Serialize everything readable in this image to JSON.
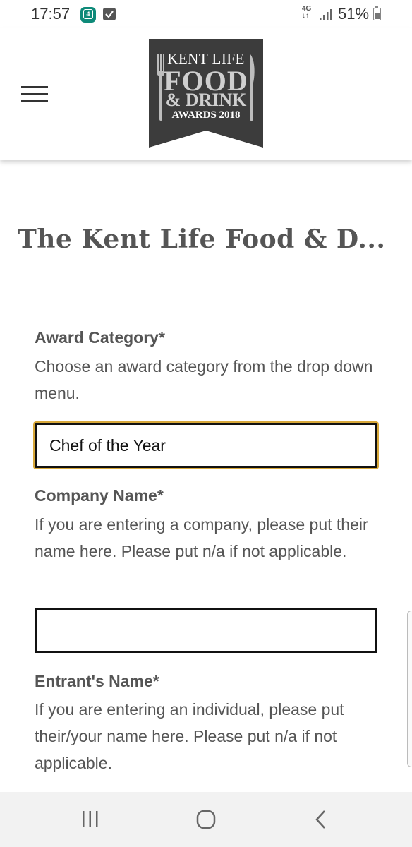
{
  "status_bar": {
    "time": "17:57",
    "notification_count": "4",
    "network_label": "4G",
    "battery": "51%"
  },
  "logo": {
    "line1": "KENT LIFE",
    "line2": "FOOD",
    "line3": "& DRINK",
    "line4": "AWARDS 2018"
  },
  "page": {
    "title": "The Kent Life Food & D..."
  },
  "form": {
    "award_category": {
      "label": "Award Category*",
      "help": "Choose an award category from the drop down menu.",
      "value": "Chef of the Year"
    },
    "company_name": {
      "label": "Company Name*",
      "help": "If you are entering a company, please put their name here. Please put n/a if not applicable.",
      "value": ""
    },
    "entrant_name": {
      "label": "Entrant's Name*",
      "help": "If you are entering an individual, please put their/your name here. Please put n/a if not applicable."
    }
  },
  "colors": {
    "logo_bg": "#3c3c3c",
    "focus_ring": "#d8a83a",
    "text": "#555555",
    "badge": "#0e8a79"
  }
}
